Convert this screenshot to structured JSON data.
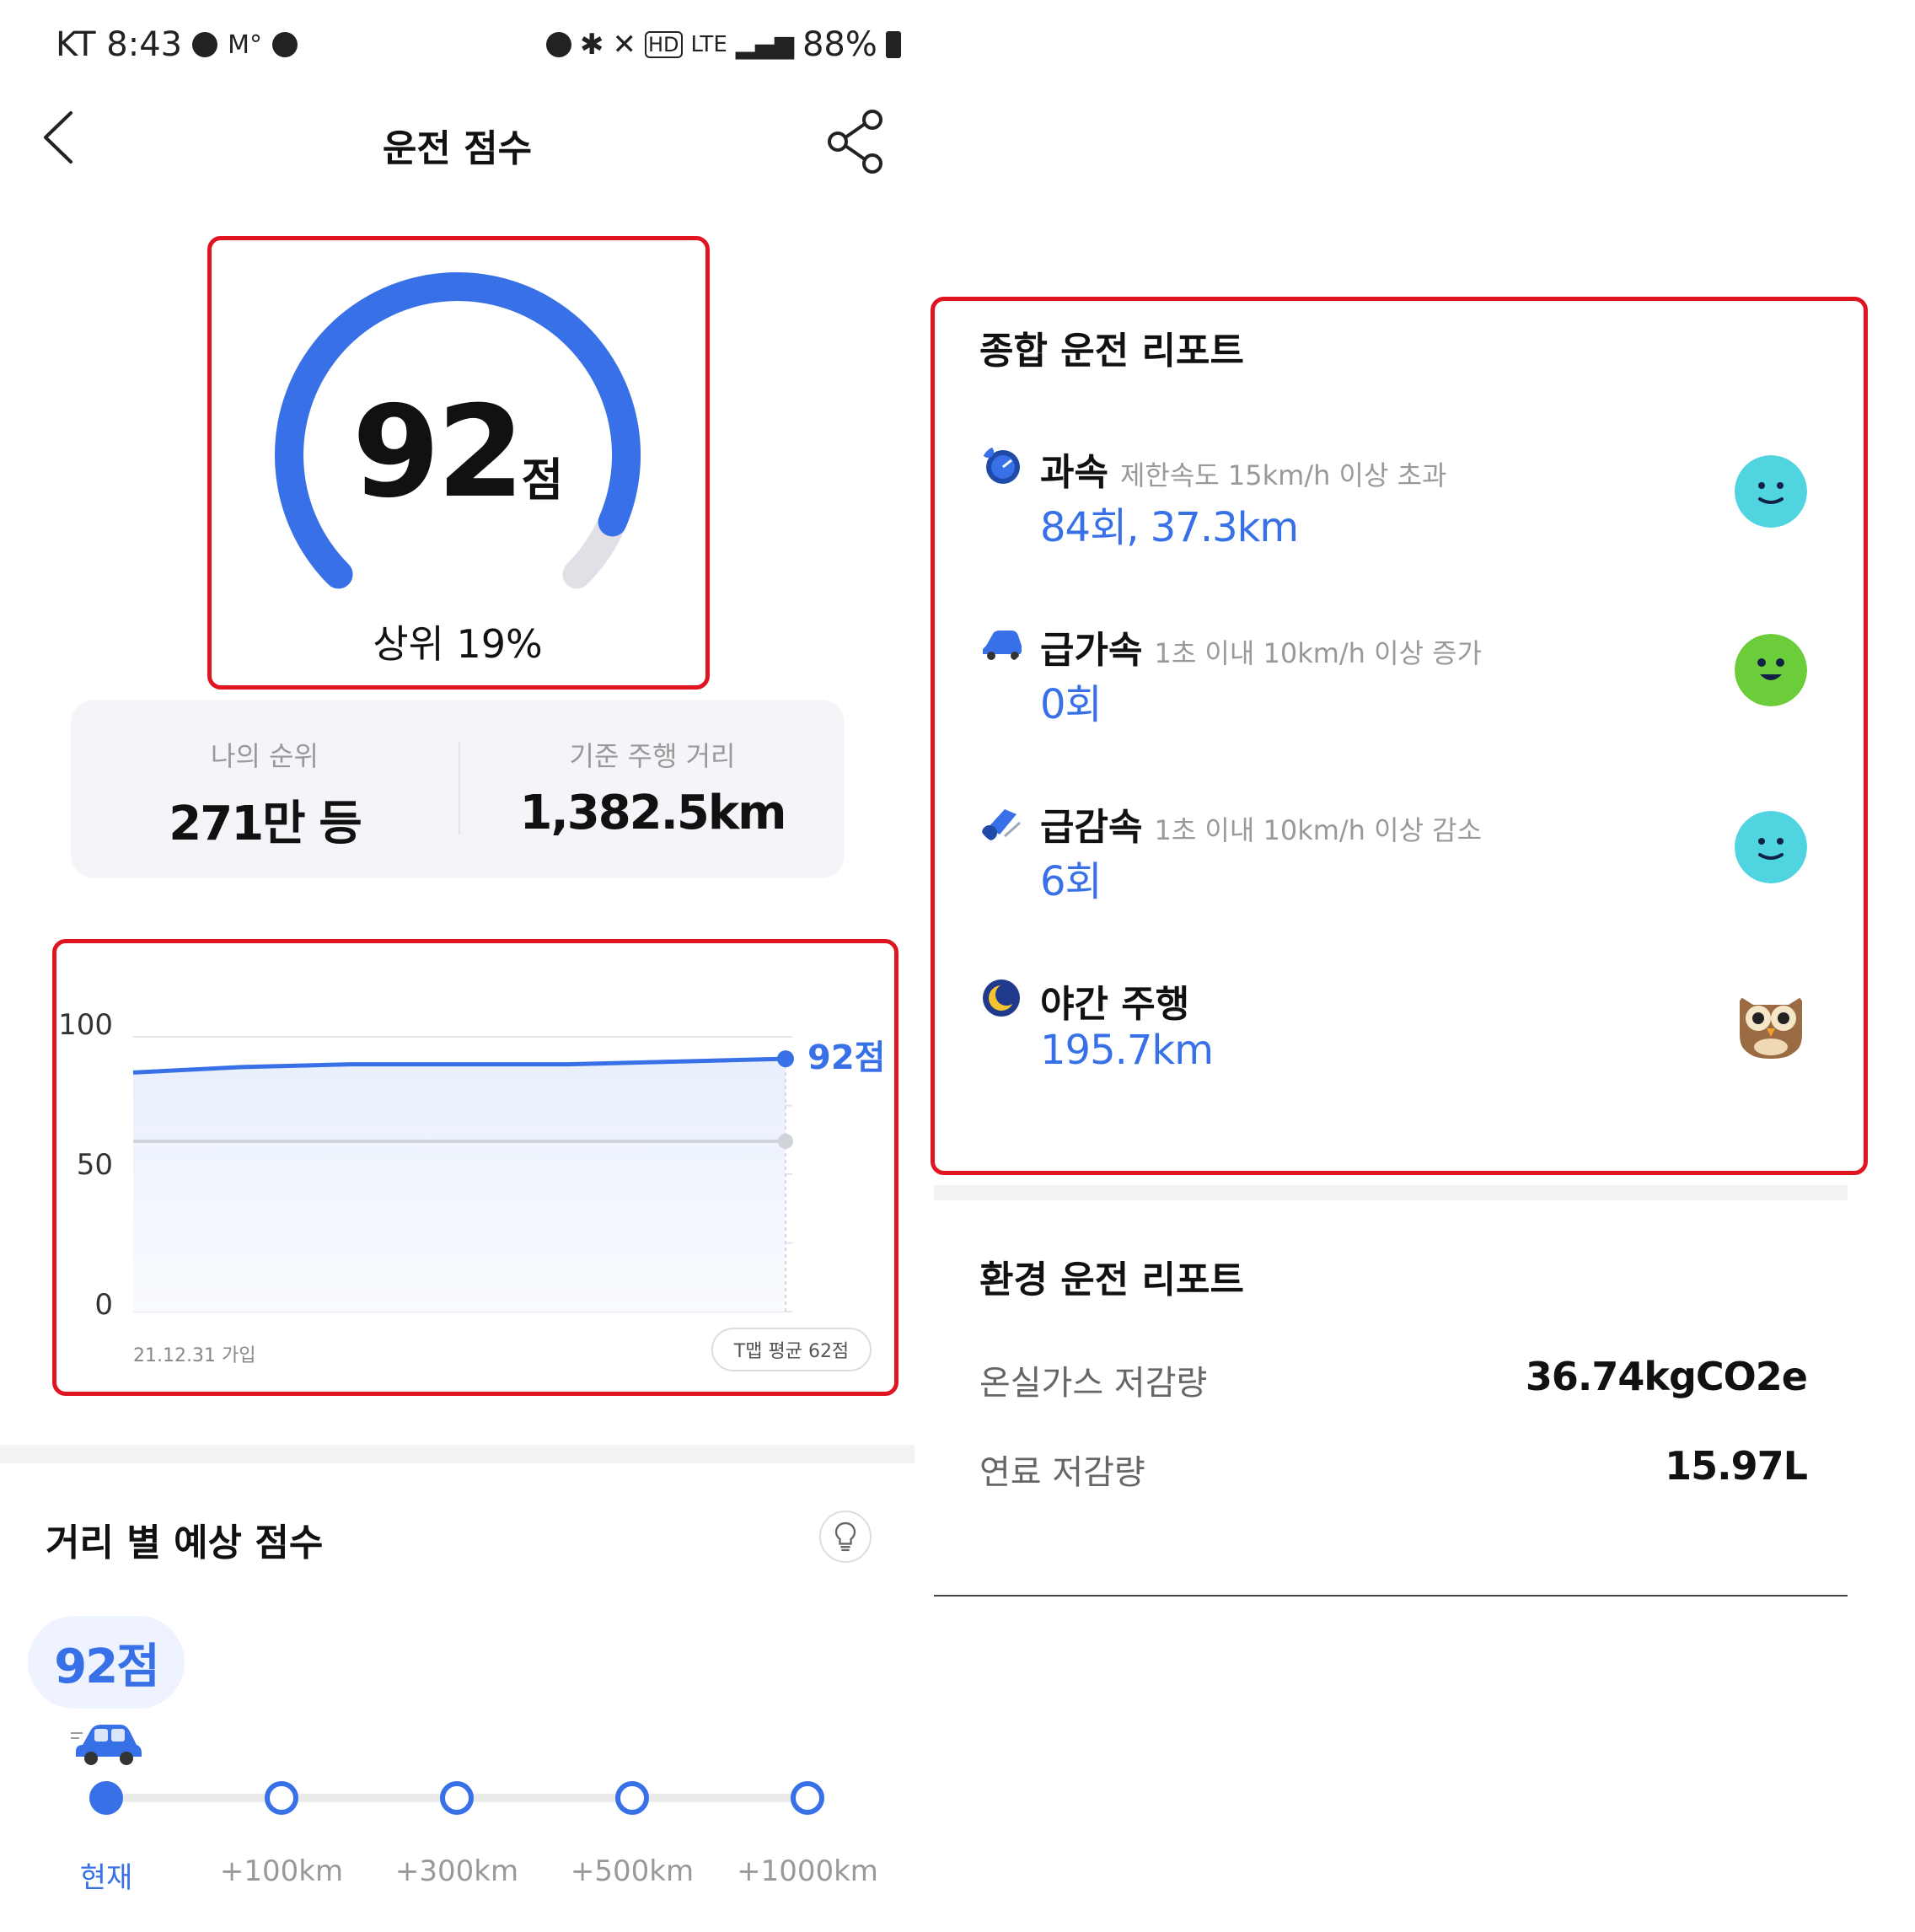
{
  "status_bar": {
    "carrier_time": "KT 8:43",
    "talk_badge": "TALK",
    "m_badge": "M°",
    "network": "LTE",
    "hd": "HD",
    "battery": "88%"
  },
  "header": {
    "title": "운전 점수",
    "back_icon": "chevron-left-icon",
    "share_icon": "share-icon"
  },
  "score": {
    "value": "92",
    "unit": "점",
    "rank_text": "상위 19%",
    "gauge_fraction": 0.92,
    "gauge_color": "#3870e8",
    "track_color": "#dfe1e6"
  },
  "stats": {
    "rank_label": "나의 순위",
    "rank_value": "271만 등",
    "distance_label": "기준 주행 거리",
    "distance_value": "1,382.5km"
  },
  "chart_data": {
    "type": "line",
    "ylim": [
      0,
      100
    ],
    "y_ticks": [
      "100",
      "50",
      "0"
    ],
    "series": [
      {
        "values": [
          87,
          89,
          90,
          90,
          90,
          91,
          92
        ],
        "color": "#3870e8"
      },
      {
        "values": [
          62,
          62,
          62,
          62,
          62,
          62,
          62
        ],
        "color": "#d0d3da"
      }
    ],
    "end_label": "92점",
    "join_label": "21.12.31 가입",
    "avg_label": "T맵 평균 62점"
  },
  "distance_forecast": {
    "title": "거리 별 예상 점수",
    "bulb_icon": "lightbulb-icon",
    "current_score": "92점",
    "steps": [
      "현재",
      "+100km",
      "+300km",
      "+500km",
      "+1000km"
    ]
  },
  "report": {
    "title": "종합 운전 리포트",
    "items": [
      {
        "title": "과속",
        "desc": "제한속도 15km/h 이상 초과",
        "value": "84회, 37.3km",
        "icon": "speedometer-icon",
        "face": "neutral-face-icon",
        "face_color": "#4fd4e0"
      },
      {
        "title": "급가속",
        "desc": "1초 이내 10km/h 이상 증가",
        "value": "0회",
        "icon": "car-acceleration-icon",
        "face": "happy-face-icon",
        "face_color": "#6ccd3a"
      },
      {
        "title": "급감속",
        "desc": "1초 이내 10km/h 이상 감소",
        "value": "6회",
        "icon": "brake-icon",
        "face": "neutral-face-icon",
        "face_color": "#4fd4e0"
      },
      {
        "title": "야간 주행",
        "desc": "",
        "value": "195.7km",
        "icon": "moon-icon",
        "face": "owl-icon",
        "face_color": "#c99a6a"
      }
    ]
  },
  "eco_report": {
    "title": "환경 운전 리포트",
    "rows": [
      {
        "label": "온실가스 저감량",
        "value": "36.74kgCO2e"
      },
      {
        "label": "연료 저감량",
        "value": "15.97L"
      }
    ]
  }
}
